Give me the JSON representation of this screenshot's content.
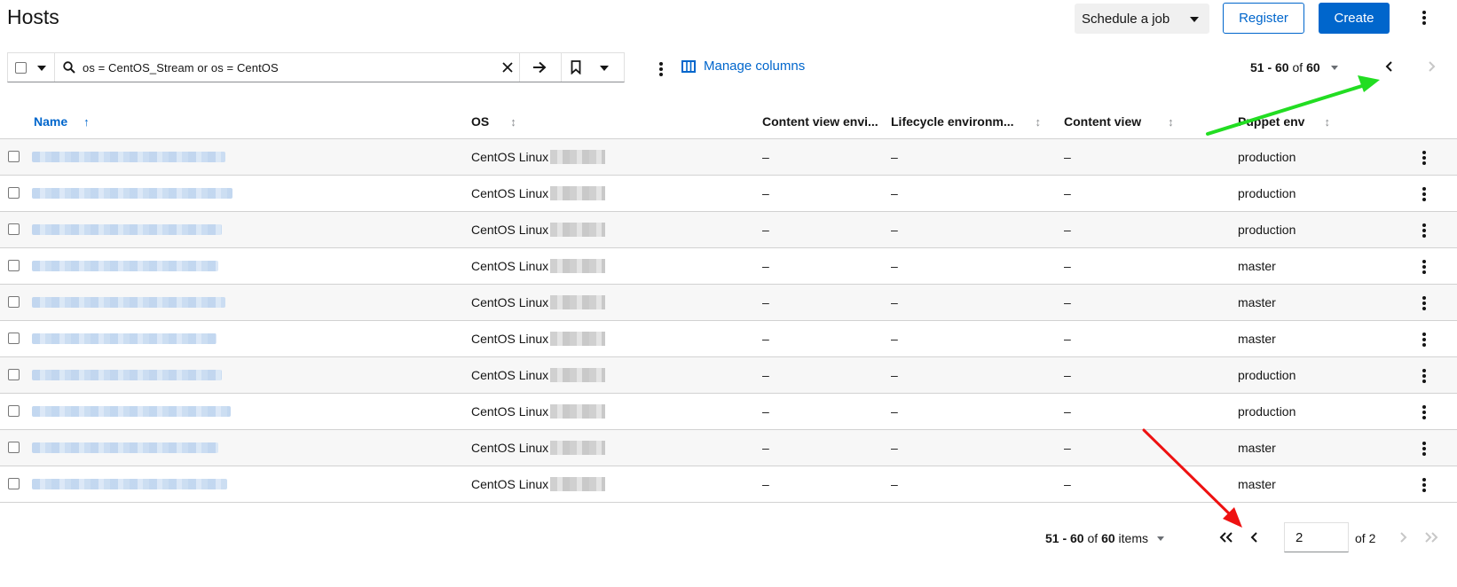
{
  "header": {
    "title": "Hosts",
    "schedule_label": "Schedule a job",
    "register_label": "Register",
    "create_label": "Create"
  },
  "toolbar": {
    "search_value": "os = CentOS_Stream or os = CentOS",
    "manage_columns_label": "Manage columns",
    "pagination_range": "51 - 60",
    "pagination_of": "of",
    "pagination_total": "60"
  },
  "table": {
    "columns": [
      "Name",
      "OS",
      "Content view envi...",
      "Lifecycle environm...",
      "Content view",
      "Puppet env"
    ],
    "rows": [
      {
        "os": "CentOS Linux",
        "cve": "–",
        "lce": "–",
        "cv": "–",
        "puppet": "production"
      },
      {
        "os": "CentOS Linux",
        "cve": "–",
        "lce": "–",
        "cv": "–",
        "puppet": "production"
      },
      {
        "os": "CentOS Linux",
        "cve": "–",
        "lce": "–",
        "cv": "–",
        "puppet": "production"
      },
      {
        "os": "CentOS Linux",
        "cve": "–",
        "lce": "–",
        "cv": "–",
        "puppet": "master"
      },
      {
        "os": "CentOS Linux",
        "cve": "–",
        "lce": "–",
        "cv": "–",
        "puppet": "master"
      },
      {
        "os": "CentOS Linux",
        "cve": "–",
        "lce": "–",
        "cv": "–",
        "puppet": "master"
      },
      {
        "os": "CentOS Linux",
        "cve": "–",
        "lce": "–",
        "cv": "–",
        "puppet": "production"
      },
      {
        "os": "CentOS Linux",
        "cve": "–",
        "lce": "–",
        "cv": "–",
        "puppet": "production"
      },
      {
        "os": "CentOS Linux",
        "cve": "–",
        "lce": "–",
        "cv": "–",
        "puppet": "master"
      },
      {
        "os": "CentOS Linux",
        "cve": "–",
        "lce": "–",
        "cv": "–",
        "puppet": "master"
      }
    ]
  },
  "bottom_pagination": {
    "range": "51 - 60",
    "of": "of",
    "total": "60",
    "items_label": "items",
    "current_page": "2",
    "of_pages": "of 2"
  },
  "colors": {
    "primary": "#0066cc",
    "arrow_green": "#22dd22",
    "arrow_red": "#ee1111"
  }
}
